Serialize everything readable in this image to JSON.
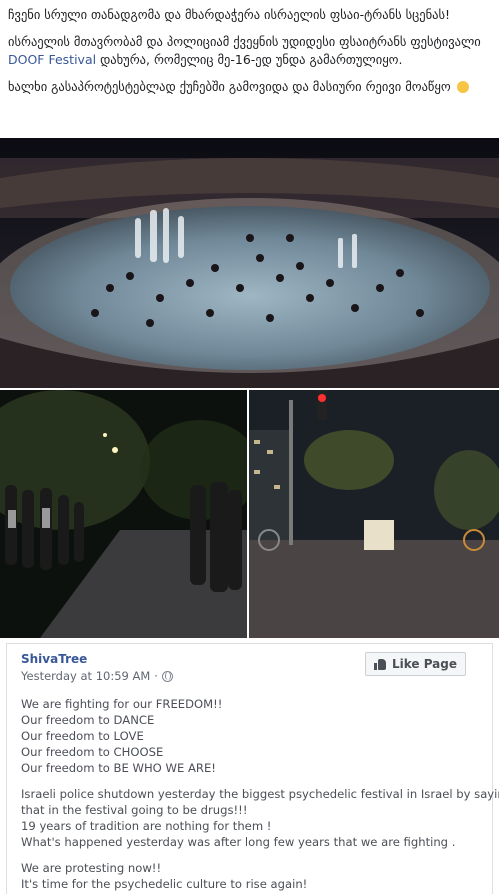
{
  "post": {
    "paragraph1": "ჩვენი სრული თანადგომა და მხარდაჭერა ისრაელის ფსაი-ტრანს სცენას!",
    "paragraph2_pre": "ისრაელის მთავრობამ და პოლიციამ ქვეყნის უდიდესი ფსაიტრანს ფესტივალი",
    "paragraph2_link": "DOOF Festival",
    "paragraph2_post": "დახურა, რომელიც მე-16-ედ უნდა გამართულიყო.",
    "paragraph3": "ხალხი გასაპროტესტებლად ქუჩებში გამოვიდა და მასიური რეივი მოაწყო"
  },
  "shared": {
    "page_name": "ShivaTree",
    "timestamp": "Yesterday at 10:59 AM",
    "separator": "·",
    "like_label": "Like Page",
    "lines_block1": [
      "We are fighting for our FREEDOM!!",
      "Our freedom to DANCE",
      "Our freedom to LOVE",
      "Our freedom to CHOOSE",
      "Our freedom to BE WHO WE ARE!"
    ],
    "lines_block2": [
      "Israeli police shutdown yesterday the biggest psychedelic festival in Israel by saying",
      "that in the festival going to be drugs!!!",
      "19 years of tradition are nothing for them !",
      "What's happened yesterday was after long few years that we are fighting ."
    ],
    "lines_block3": [
      "We are protesting now!!",
      "It's time for the psychedelic culture to rise again!"
    ]
  },
  "icons": {
    "emoji": "fist-emoji-icon",
    "globe": "globe-icon",
    "like": "thumbs-up-icon"
  },
  "colors": {
    "link": "#385898",
    "text": "#1c1e21",
    "muted": "#616770"
  }
}
